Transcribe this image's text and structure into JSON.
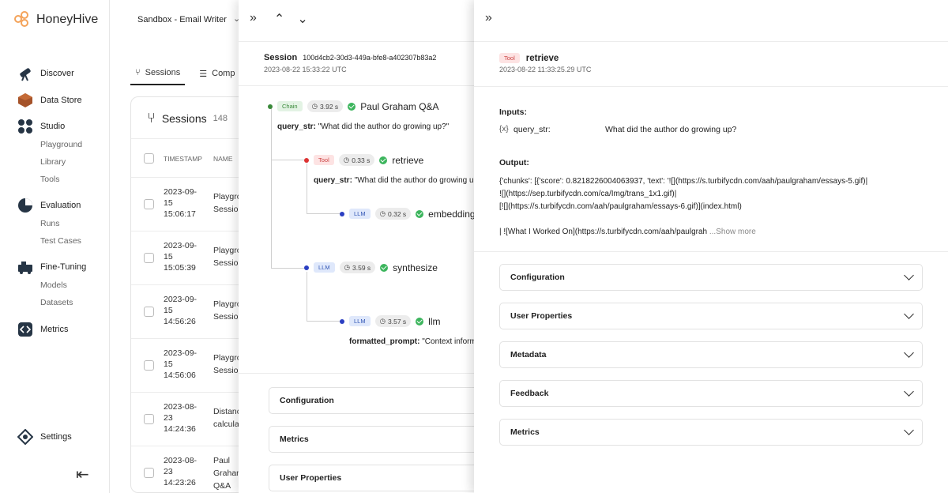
{
  "app": {
    "name": "HoneyHive",
    "project": "Sandbox - Email Writer"
  },
  "colors": {
    "accent": "#f4a35a",
    "chain": "#3a8a3a",
    "tool": "#cc4444",
    "llm": "#3357b5",
    "success": "#3cb55d"
  },
  "sidebar": {
    "discover": "Discover",
    "data_store": "Data Store",
    "studio": "Studio",
    "studio_items": [
      "Playground",
      "Library",
      "Tools"
    ],
    "evaluation": "Evaluation",
    "evaluation_items": [
      "Runs",
      "Test Cases"
    ],
    "fine_tuning": "Fine-Tuning",
    "fine_tuning_items": [
      "Models",
      "Datasets"
    ],
    "metrics": "Metrics",
    "settings": "Settings"
  },
  "list": {
    "tabs": [
      "Sessions",
      "Comp"
    ],
    "title": "Sessions",
    "count": "148",
    "headers": {
      "timestamp": "TIMESTAMP",
      "name": "NAME"
    },
    "rows": [
      {
        "ts": [
          "2023-09-",
          "15",
          "15:06:17"
        ],
        "name": [
          "Playgro",
          "Sessio"
        ]
      },
      {
        "ts": [
          "2023-09-",
          "15",
          "15:05:39"
        ],
        "name": [
          "Playgro",
          "Sessio"
        ]
      },
      {
        "ts": [
          "2023-09-",
          "15",
          "14:56:26"
        ],
        "name": [
          "Playgro",
          "Sessio"
        ]
      },
      {
        "ts": [
          "2023-09-",
          "15",
          "14:56:06"
        ],
        "name": [
          "Playgro",
          "Sessio"
        ]
      },
      {
        "ts": [
          "2023-08-",
          "23",
          "14:24:36"
        ],
        "name": [
          "Distanc",
          "calculat"
        ]
      },
      {
        "ts": [
          "2023-08-",
          "23",
          "14:23:26"
        ],
        "name": [
          "Paul",
          "Grahan",
          "Q&A"
        ]
      }
    ]
  },
  "session": {
    "label": "Session",
    "id": "100d4cb2-30d3-449a-bfe8-a402307b83a2",
    "date": "2023-08-22 15:33:22 UTC",
    "trace": [
      {
        "type": "Chain",
        "duration": "3.92 s",
        "name": "Paul Graham Q&A",
        "param_key": "query_str:",
        "param_val": "\"What did the author do growing up?\""
      },
      {
        "type": "Tool",
        "duration": "0.33 s",
        "name": "retrieve",
        "param_key": "query_str:",
        "param_val": "\"What did the author do growing u"
      },
      {
        "type": "LLM",
        "duration": "0.32 s",
        "name": "embedding"
      },
      {
        "type": "LLM",
        "duration": "3.59 s",
        "name": "synthesize"
      },
      {
        "type": "LLM",
        "duration": "3.57 s",
        "name": "llm",
        "param_key": "formatted_prompt:",
        "param_val": "\"Context inform"
      }
    ],
    "sections": [
      "Configuration",
      "Metrics",
      "User Properties"
    ]
  },
  "detail": {
    "type": "Tool",
    "name": "retrieve",
    "date": "2023-08-22 11:33:25.29 UTC",
    "inputs_label": "Inputs:",
    "input_icon": "{x}",
    "input_key": "query_str:",
    "input_val": "What did the author do growing up?",
    "output_label": "Output:",
    "output_lines": [
      "{'chunks': [{'score': 0.8218226004063937, 'text': '![](https://s.turbifycdn.com/aah/paulgraham/essays-5.gif)|",
      "![](https://sep.turbifycdn.com/ca/Img/trans_1x1.gif)|",
      "[![](https://s.turbifycdn.com/aah/paulgraham/essays-6.gif)](index.html)"
    ],
    "output_tail": "| ![What I Worked On](https://s.turbifycdn.com/aah/paulgrah",
    "show_more": "...Show more",
    "sections": [
      "Configuration",
      "User Properties",
      "Metadata",
      "Feedback",
      "Metrics"
    ]
  }
}
